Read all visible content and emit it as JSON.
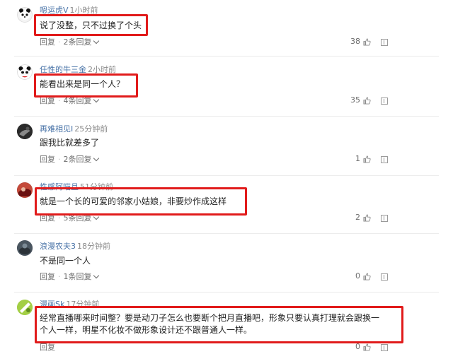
{
  "comments": [
    {
      "username": "嗯运虎V",
      "time": "1小时前",
      "text": "说了没整，只不过换了个头",
      "reply_label": "回复",
      "replies_label": "2条回复",
      "likes": "38"
    },
    {
      "username": "任性的牛三金",
      "time": "2小时前",
      "text": "能看出来是同一个人？",
      "reply_label": "回复",
      "replies_label": "4条回复",
      "likes": "35"
    },
    {
      "username": "再难相见I",
      "time": "25分钟前",
      "text": "跟我比就差多了",
      "reply_label": "回复",
      "replies_label": "2条回复",
      "likes": "1"
    },
    {
      "username": "性感阿喵且",
      "time": "51分钟前",
      "text": "就是一个长的可爱的邻家小姑娘，非要炒作成这样",
      "reply_label": "回复",
      "replies_label": "5条回复",
      "likes": "2"
    },
    {
      "username": "浪漫农夫3",
      "time": "18分钟前",
      "text": "不是同一个人",
      "reply_label": "回复",
      "replies_label": "1条回复",
      "likes": "0"
    },
    {
      "username": "漫画Sk",
      "time": "17分钟前",
      "text": "经常直播哪来时间整？要是动刀子怎么也要断个把月直播吧，形象只要认真打理就会跟换一个人一样，明星不化妆不做形象设计还不跟普通人一样。",
      "reply_label": "回复",
      "likes": "0"
    }
  ],
  "icons": {
    "like": "thumbs-up-icon",
    "report": "report-icon"
  },
  "colors": {
    "highlight": "#e11b1b",
    "username": "#4a74a8"
  }
}
